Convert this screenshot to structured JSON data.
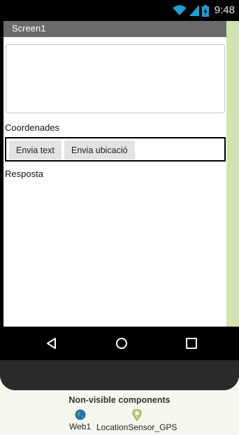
{
  "status_bar": {
    "time": "9:48"
  },
  "screen": {
    "title": "Screen1"
  },
  "textbox": {
    "value": ""
  },
  "labels": {
    "coords": "Coordenades",
    "response": "Resposta"
  },
  "buttons": {
    "send_text": "Envia text",
    "send_location": "Envia ubicació"
  },
  "non_visible": {
    "title": "Non-visible components",
    "components": [
      {
        "label": "Web1",
        "icon": "globe-icon"
      },
      {
        "label": "LocationSensor_GPS",
        "icon": "location-pin-icon"
      }
    ]
  },
  "colors": {
    "title_bar": "#6b6b6b",
    "status_accent": "#1e9fd6",
    "sidebar_strip": "#d3e3b0",
    "button_bg": "#e3e3e3"
  }
}
